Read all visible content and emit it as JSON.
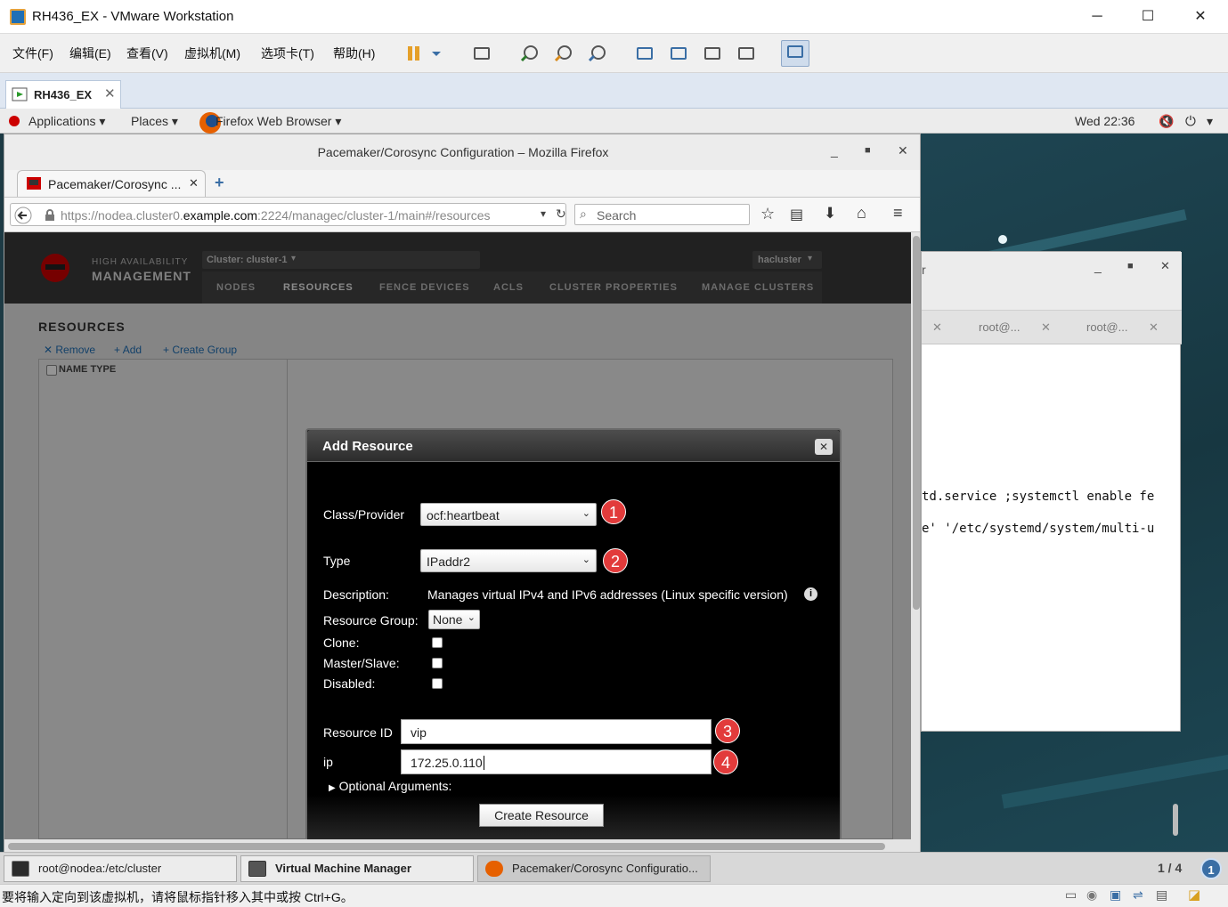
{
  "vmware": {
    "title": "RH436_EX - VMware Workstation",
    "tab": "RH436_EX",
    "menu": [
      "文件(F)",
      "编辑(E)",
      "查看(V)",
      "虚拟机(M)",
      "选项卡(T)",
      "帮助(H)"
    ],
    "status": "要将输入定向到该虚拟机，请将鼠标指针移入其中或按 Ctrl+G。"
  },
  "gnome": {
    "applications": "Applications",
    "places": "Places",
    "app": "Firefox Web Browser",
    "clock": "Wed 22:36"
  },
  "firefox": {
    "title": "Pacemaker/Corosync Configuration – Mozilla Firefox",
    "tab": "Pacemaker/Corosync ...",
    "url_pre": "https://nodea.cluster0.",
    "url_dom": "example.com",
    "url_post": ":2224/managec/cluster-1/main#/resources",
    "search_placeholder": "Search"
  },
  "pcs": {
    "ha_line1": "HIGH AVAILABILITY",
    "ha_line2": "MANAGEMENT",
    "cluster_sel": "Cluster: cluster-1",
    "user": "hacluster",
    "nav": [
      "NODES",
      "RESOURCES",
      "FENCE DEVICES",
      "ACLS",
      "CLUSTER PROPERTIES",
      "MANAGE CLUSTERS"
    ],
    "heading": "RESOURCES",
    "actions": [
      "Remove",
      "Add",
      "Create Group"
    ],
    "col_header": "NAME TYPE"
  },
  "modal": {
    "title": "Add Resource",
    "class_label": "Class/Provider",
    "class_value": "ocf:heartbeat",
    "type_label": "Type",
    "type_value": "IPaddr2",
    "desc_label": "Description:",
    "desc_value": "Manages virtual IPv4 and IPv6 addresses (Linux specific version)",
    "group_label": "Resource Group:",
    "group_value": "None",
    "clone_label": "Clone:",
    "ms_label": "Master/Slave:",
    "disabled_label": "Disabled:",
    "rid_label": "Resource ID",
    "rid_value": "vip",
    "ip_label": "ip",
    "ip_value": "172.25.0.110",
    "optional": "Optional Arguments:",
    "create": "Create Resource",
    "badges": [
      "1",
      "2",
      "3",
      "4"
    ]
  },
  "terminal": {
    "tabs": [
      "root@...",
      "root@..."
    ],
    "line1": "td.service ;systemctl enable fe",
    "line2": "e' '/etc/systemd/system/multi-u",
    "frag": "r"
  },
  "taskbar": {
    "items": [
      "root@nodea:/etc/cluster",
      "Virtual Machine Manager",
      "Pacemaker/Corosync Configuratio..."
    ],
    "pager": "1 / 4",
    "pager_badge": "1"
  }
}
